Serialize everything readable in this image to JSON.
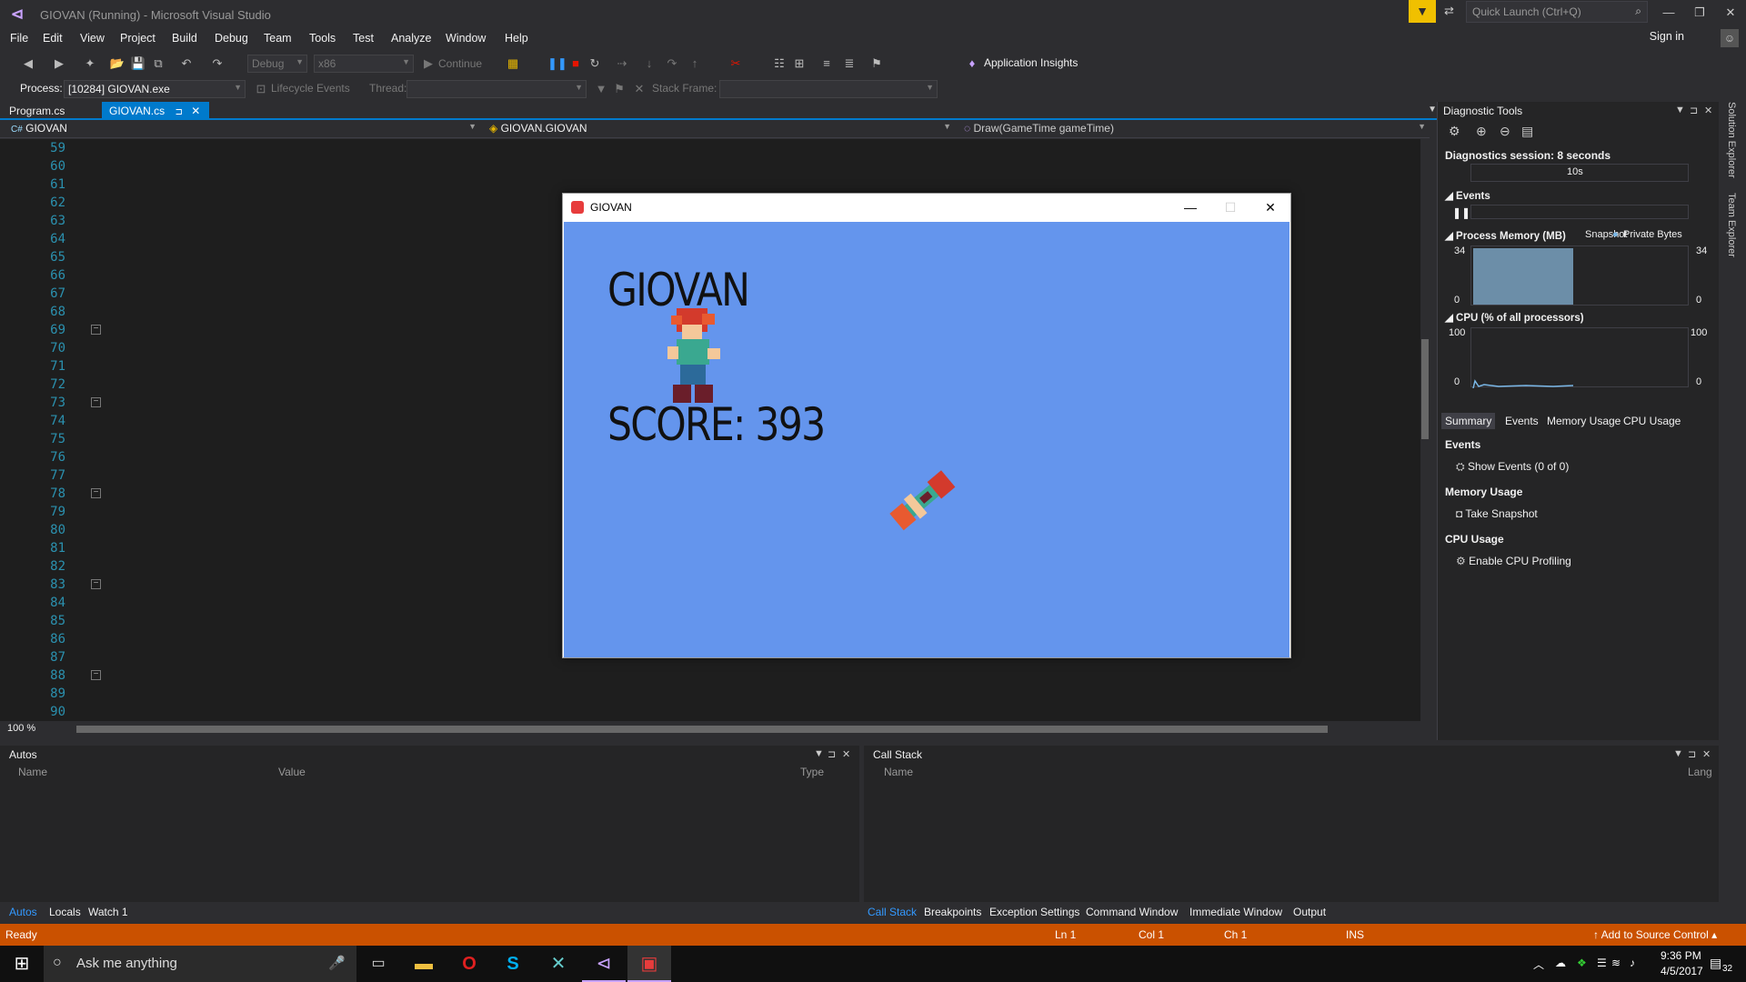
{
  "window": {
    "title": "GIOVAN (Running) - Microsoft Visual Studio",
    "quick_launch_placeholder": "Quick Launch (Ctrl+Q)",
    "sign_in": "Sign in"
  },
  "menu": [
    "File",
    "Edit",
    "View",
    "Project",
    "Build",
    "Debug",
    "Team",
    "Tools",
    "Test",
    "Analyze",
    "Window",
    "Help"
  ],
  "toolbar": {
    "config": "Debug",
    "platform": "x86",
    "continue": "Continue",
    "app_insights": "Application Insights"
  },
  "toolbar2": {
    "process_label": "Process:",
    "process_value": "[10284] GIOVAN.exe",
    "lifecycle": "Lifecycle Events",
    "thread_label": "Thread:",
    "stack_frame_label": "Stack Frame:"
  },
  "tabs": [
    {
      "label": "Program.cs"
    },
    {
      "label": "GIOVAN.cs"
    }
  ],
  "nav": {
    "project": "GIOVAN",
    "class": "GIOVAN.GIOVAN",
    "member": "Draw(GameTime gameTime)"
  },
  "editor": {
    "zoom": "100 %",
    "line_numbers": [
      "59",
      "60",
      "61",
      "62",
      "63",
      "64",
      "65",
      "66",
      "67",
      "68",
      "69",
      "70",
      "71",
      "72",
      "73",
      "74",
      "75",
      "76",
      "77",
      "78",
      "79",
      "80",
      "81",
      "82",
      "83",
      "84",
      "85",
      "86",
      "87",
      "88",
      "89",
      "90"
    ]
  },
  "diagnostics": {
    "title": "Diagnostic Tools",
    "session": "Diagnostics session: 8 seconds",
    "timeline_label": "10s",
    "events_header": "Events",
    "memory_header": "Process Memory (MB)",
    "memory_legend_snapshot": "Snapshot",
    "memory_legend_private": "Private Bytes",
    "memory_max": "34",
    "memory_min": "0",
    "memory_level": 1.0,
    "cpu_header": "CPU (% of all processors)",
    "cpu_max": "100",
    "cpu_min": "0",
    "subtabs": [
      "Summary",
      "Events",
      "Memory Usage",
      "CPU Usage"
    ],
    "events_section": "Events",
    "show_events": "Show Events (0 of 0)",
    "memory_section": "Memory Usage",
    "take_snapshot": "Take Snapshot",
    "cpu_section": "CPU Usage",
    "enable_cpu": "Enable CPU Profiling"
  },
  "side_strip": [
    "Solution Explorer",
    "Team Explorer"
  ],
  "autos": {
    "title": "Autos",
    "col_name": "Name",
    "col_value": "Value",
    "col_type": "Type"
  },
  "callstack": {
    "title": "Call Stack",
    "col_name": "Name",
    "col_lang": "Lang"
  },
  "bottom_tabs_left": [
    "Autos",
    "Locals",
    "Watch 1"
  ],
  "bottom_tabs_right": [
    "Call Stack",
    "Breakpoints",
    "Exception Settings",
    "Command Window",
    "Immediate Window",
    "Output"
  ],
  "status": {
    "ready": "Ready",
    "ln": "Ln 1",
    "col": "Col 1",
    "ch": "Ch 1",
    "ins": "INS",
    "source_control": "Add to Source Control"
  },
  "game": {
    "window_title": "GIOVAN",
    "name": "GIOVAN",
    "score": "SCORE: 393"
  },
  "taskbar": {
    "search": "Ask me anything",
    "time": "9:36 PM",
    "date": "4/5/2017",
    "notifications": "32"
  }
}
